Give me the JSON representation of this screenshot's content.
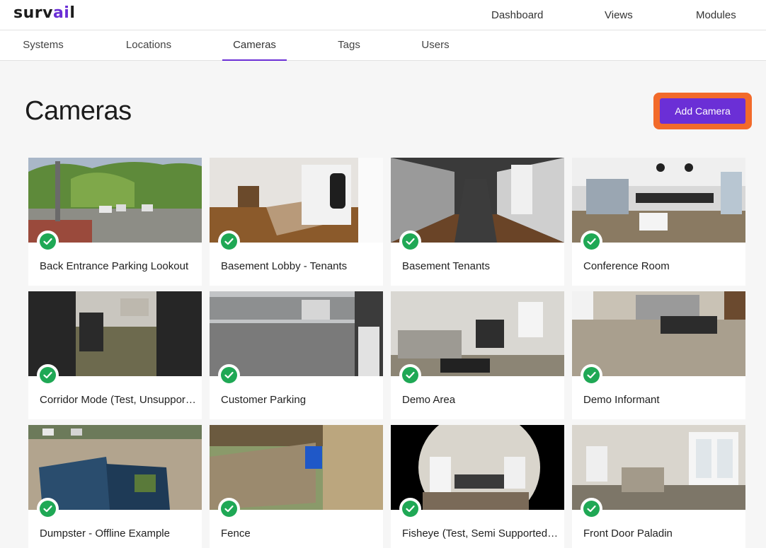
{
  "brand": {
    "logo_main": "surv",
    "logo_accent": "ai",
    "logo_tail": "l",
    "accent_color": "#6b2fd6"
  },
  "topnav": {
    "items": [
      {
        "label": "Dashboard"
      },
      {
        "label": "Views"
      },
      {
        "label": "Modules"
      }
    ]
  },
  "subnav": {
    "active": "Cameras",
    "tabs": [
      {
        "label": "Systems"
      },
      {
        "label": "Locations"
      },
      {
        "label": "Cameras"
      },
      {
        "label": "Tags"
      },
      {
        "label": "Users"
      }
    ]
  },
  "page": {
    "title": "Cameras",
    "add_button_label": "Add Camera",
    "highlight_color": "#f26a2a"
  },
  "status_color": "#1fa855",
  "cameras": [
    {
      "name": "Back Entrance Parking Lookout",
      "status": "online"
    },
    {
      "name": "Basement Lobby - Tenants",
      "status": "online"
    },
    {
      "name": "Basement Tenants",
      "status": "online"
    },
    {
      "name": "Conference Room",
      "status": "online"
    },
    {
      "name": "Corridor Mode (Test, Unsupported)",
      "status": "online"
    },
    {
      "name": "Customer Parking",
      "status": "online"
    },
    {
      "name": "Demo Area",
      "status": "online"
    },
    {
      "name": "Demo Informant",
      "status": "online"
    },
    {
      "name": "Dumpster - Offline Example",
      "status": "online"
    },
    {
      "name": "Fence",
      "status": "online"
    },
    {
      "name": "Fisheye (Test, Semi Supported Feed)",
      "status": "online"
    },
    {
      "name": "Front Door Paladin",
      "status": "online"
    }
  ]
}
